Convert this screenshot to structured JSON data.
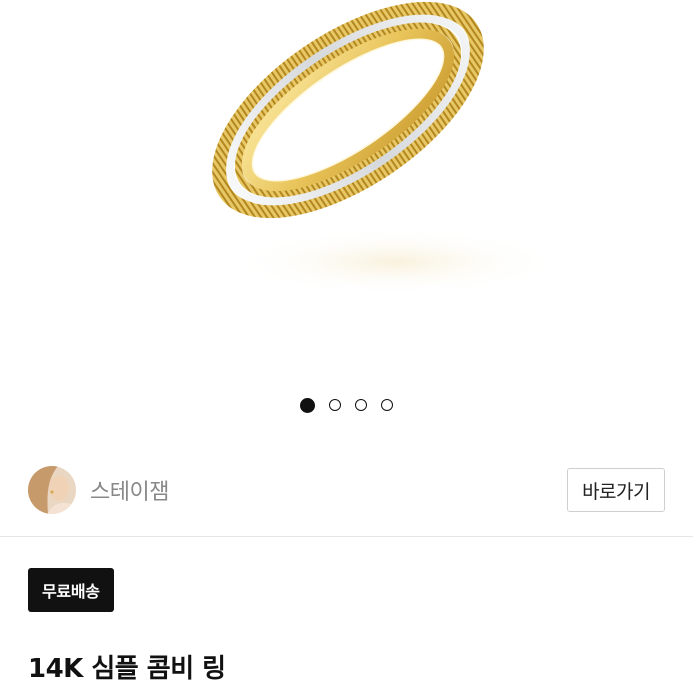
{
  "gallery": {
    "image_subject": "ring-photo",
    "dot_count": 4,
    "active_index": 0
  },
  "seller": {
    "name": "스테이잼",
    "goto_label": "바로가기"
  },
  "product": {
    "badge": "무료배송",
    "title": "14K 심플 콤비 링"
  },
  "colors": {
    "badge_bg": "#111111",
    "seller_name": "#888888",
    "gold": "#d9b24a",
    "silver": "#e6e8ea"
  }
}
